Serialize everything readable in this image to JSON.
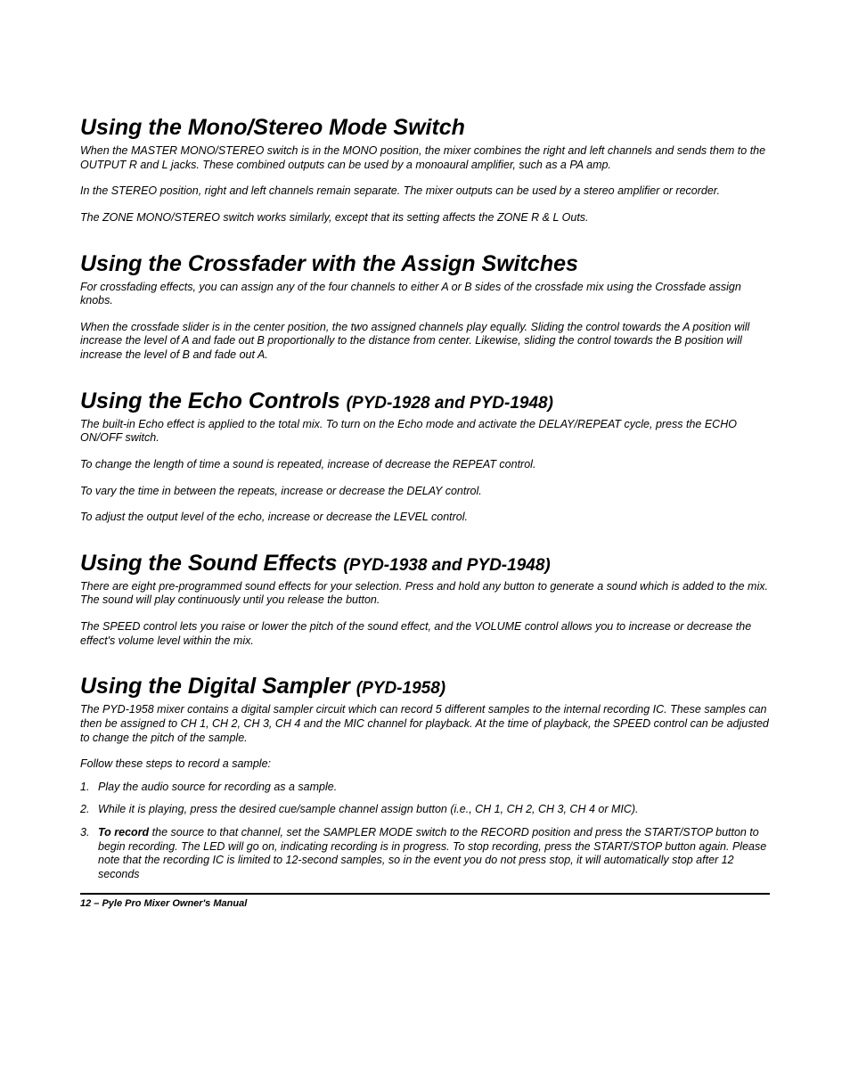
{
  "sections": [
    {
      "heading_main": "Using the Mono/Stereo Mode Switch",
      "heading_sub": "",
      "paragraphs": [
        "When the MASTER MONO/STEREO switch is in the MONO position, the mixer combines the right and left channels and sends them to the OUTPUT R and L jacks. These combined outputs can be used by a monoaural amplifier, such as a PA amp.",
        "In the STEREO position, right and left channels remain separate. The mixer outputs can be used by a stereo amplifier or recorder.",
        "The ZONE MONO/STEREO switch works similarly, except that its setting affects the ZONE R & L Outs."
      ]
    },
    {
      "heading_main": "Using the Crossfader with the Assign Switches",
      "heading_sub": "",
      "paragraphs": [
        "For crossfading effects, you can assign any of the four channels to either A or B sides of the crossfade mix using the Crossfade assign knobs.",
        "When the crossfade slider is in the center position, the two assigned channels play equally. Sliding the control towards the A position will increase the level of A and fade out B proportionally to the distance from center. Likewise, sliding the control towards the B position will increase the level of B and fade out A."
      ]
    },
    {
      "heading_main": "Using the Echo Controls ",
      "heading_sub": "(PYD-1928 and PYD-1948)",
      "paragraphs": [
        "The built-in Echo effect is applied to the total mix. To turn on the Echo mode and activate the DELAY/REPEAT cycle, press the ECHO ON/OFF switch.",
        "To change the length of time a sound is repeated, increase of decrease the REPEAT control.",
        "To vary the time in between the repeats, increase or decrease the DELAY control.",
        "To adjust the output level of the echo, increase or decrease the LEVEL control."
      ]
    },
    {
      "heading_main": "Using the Sound Effects ",
      "heading_sub": "(PYD-1938 and PYD-1948)",
      "paragraphs": [
        "There are eight pre-programmed sound effects for your selection. Press and hold any button to generate a sound which is added to the mix. The sound will play continuously until you release the button.",
        "The SPEED control lets you raise or lower the pitch of the sound effect, and the VOLUME control allows you to increase or decrease the effect's volume level within the mix."
      ]
    },
    {
      "heading_main": "Using the Digital Sampler ",
      "heading_sub": "(PYD-1958)",
      "paragraphs": [
        "The PYD-1958 mixer contains a digital sampler circuit which can record 5 different samples to the internal recording IC. These samples can then be assigned to CH 1, CH 2, CH 3, CH 4 and the MIC channel for playback. At the time of playback, the SPEED control can be adjusted to change the pitch of the sample.",
        "Follow these steps to record a sample:"
      ]
    }
  ],
  "steps": [
    {
      "n": "1.",
      "text": "Play the audio source for recording as a sample."
    },
    {
      "n": "2.",
      "text": "While it is playing, press the desired cue/sample channel assign button (i.e., CH 1, CH 2, CH 3, CH 4 or MIC)."
    },
    {
      "n": "3.",
      "bold": "To record",
      "text": " the source to that channel, set the SAMPLER MODE switch to the RECORD position and press the START/STOP button to begin recording. The LED will go on, indicating recording is in progress. To stop recording, press the START/STOP button again.  Please note that the recording IC is limited to 12-second samples, so in the event you do not press stop, it will automatically stop after 12 seconds"
    }
  ],
  "footer": "12 – Pyle Pro Mixer Owner's Manual"
}
